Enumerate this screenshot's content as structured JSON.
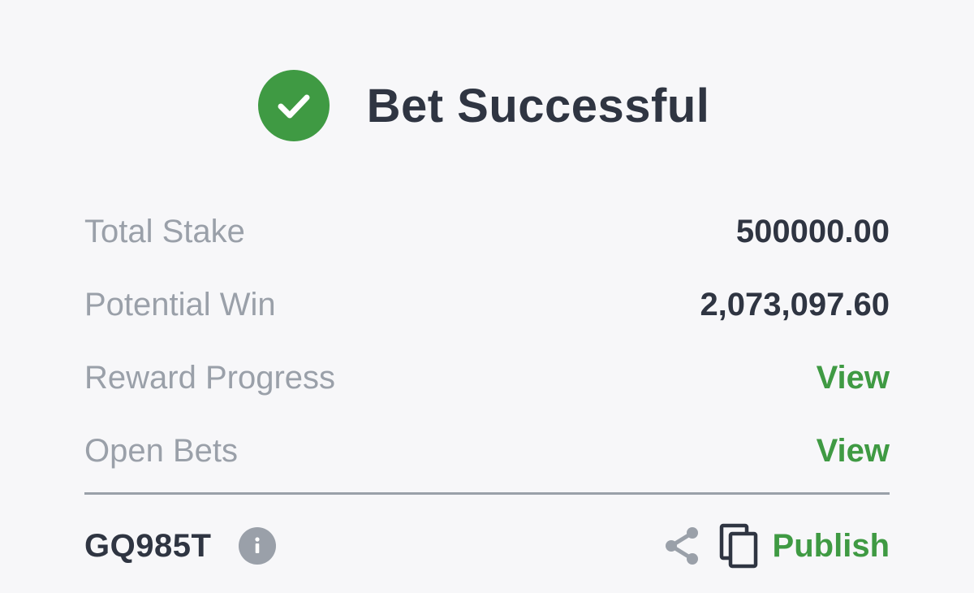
{
  "header": {
    "title": "Bet Successful",
    "icon": "check-circle-icon",
    "accent_color": "#3f9a43"
  },
  "summary": {
    "rows": [
      {
        "label": "Total Stake",
        "value": "500000.00"
      },
      {
        "label": "Potential Win",
        "value": "2,073,097.60"
      },
      {
        "label": "Reward Progress",
        "value": "View"
      },
      {
        "label": "Open Bets",
        "value": "View"
      }
    ]
  },
  "footer": {
    "booking_code": "GQ985T",
    "info_icon": "info-icon",
    "share_icon": "share-icon",
    "copy_icon": "copy-icon",
    "publish_label": "Publish"
  }
}
